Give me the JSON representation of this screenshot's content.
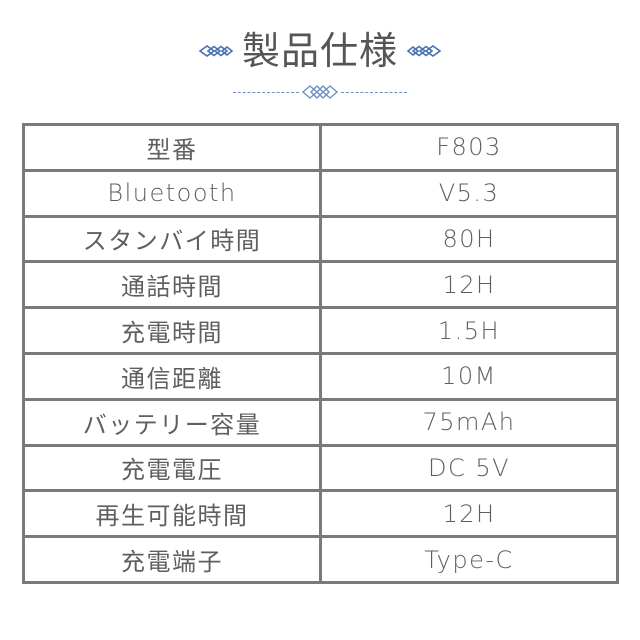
{
  "header": {
    "title": "製品仕様",
    "ornament_color": "#4a72b0",
    "title_color": "#555555"
  },
  "icons": {
    "left_ornament": "diamond-chain-icon",
    "right_ornament": "diamond-chain-icon",
    "divider_ornament": "diamond-chain-icon"
  },
  "table": {
    "border_color": "#7a7a7a",
    "text_color": "#5f5f5f",
    "rows": [
      {
        "label": "型番",
        "value": "F803"
      },
      {
        "label": "Bluetooth",
        "value": "V5.3"
      },
      {
        "label": "スタンバイ時間",
        "value": "80H"
      },
      {
        "label": "通話時間",
        "value": "12H"
      },
      {
        "label": "充電時間",
        "value": "1.5H"
      },
      {
        "label": "通信距離",
        "value": "10M"
      },
      {
        "label": "バッテリー容量",
        "value": "75mAh"
      },
      {
        "label": "充電電圧",
        "value": "DC 5V"
      },
      {
        "label": "再生可能時間",
        "value": "12H"
      },
      {
        "label": "充電端子",
        "value": "Type-C"
      }
    ]
  }
}
